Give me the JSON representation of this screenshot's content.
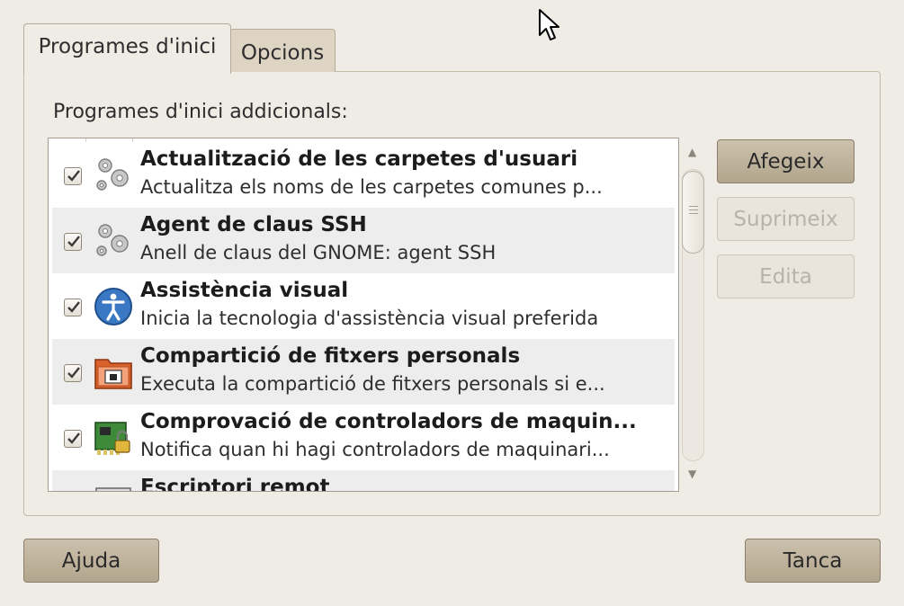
{
  "tabs": [
    {
      "label": "Programes d'inici",
      "active": true
    },
    {
      "label": "Opcions",
      "active": false
    }
  ],
  "section_label": "Programes d'inici addicionals:",
  "startup_programs": [
    {
      "title": "Actualització de les carpetes d'usuari",
      "description": "Actualitza els noms de les carpetes comunes p...",
      "checked": true,
      "icon": "gears-icon"
    },
    {
      "title": "Agent de claus SSH",
      "description": "Anell de claus del GNOME: agent SSH",
      "checked": true,
      "icon": "gears-icon"
    },
    {
      "title": "Assistència visual",
      "description": "Inicia la tecnologia d'assistència visual preferida",
      "checked": true,
      "icon": "accessibility-icon"
    },
    {
      "title": "Compartició de fitxers personals",
      "description": "Executa la compartició de fitxers personals si e...",
      "checked": true,
      "icon": "shared-folder-icon"
    },
    {
      "title": "Comprovació de controladors de maquin...",
      "description": "Notifica quan hi hagi controladors de maquinari...",
      "checked": true,
      "icon": "hardware-driver-icon"
    },
    {
      "title": "Escriptori remot",
      "description": "",
      "checked": true,
      "icon": "remote-desktop-icon"
    }
  ],
  "buttons": {
    "add": "Afegeix",
    "remove": "Suprimeix",
    "edit": "Edita",
    "help": "Ajuda",
    "close": "Tanca"
  },
  "colors": {
    "window_bg": "#efebe5",
    "button_active": "#c0b49e",
    "row_alternate": "#ededed"
  }
}
